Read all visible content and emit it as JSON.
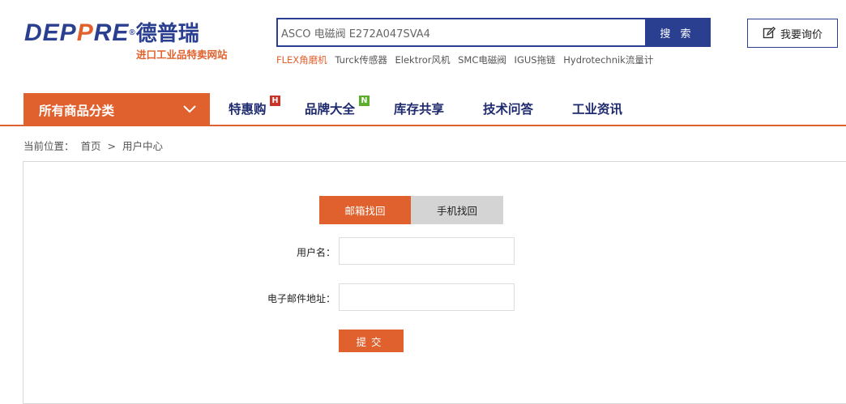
{
  "logo": {
    "brand_part1": "DEP",
    "brand_part2": "P",
    "brand_part3": "RE",
    "brand_cn": "德普瑞",
    "registered": "®",
    "tagline": "进口工业品特卖网站"
  },
  "search": {
    "value": "ASCO 电磁阀 E272A047SVA4",
    "button_label": "搜 索"
  },
  "hot_links": [
    {
      "label": "FLEX角磨机",
      "highlight": true
    },
    {
      "label": "Turck传感器",
      "highlight": false
    },
    {
      "label": "Elektror风机",
      "highlight": false
    },
    {
      "label": "SMC电磁阀",
      "highlight": false
    },
    {
      "label": "IGUS拖链",
      "highlight": false
    },
    {
      "label": "Hydrotechnik流量计",
      "highlight": false
    }
  ],
  "inquiry_button": {
    "label": "我要询价",
    "icon": "edit-icon"
  },
  "nav": {
    "category_label": "所有商品分类",
    "items": [
      {
        "label": "特惠购",
        "badge": "H",
        "badge_color": "#c8342a"
      },
      {
        "label": "品牌大全",
        "badge": "N",
        "badge_color": "#5aae2c"
      },
      {
        "label": "库存共享",
        "badge": ""
      },
      {
        "label": "技术问答",
        "badge": ""
      },
      {
        "label": "工业资讯",
        "badge": ""
      }
    ]
  },
  "breadcrumb": {
    "prefix": "当前位置：",
    "home": "首页",
    "separator": ">",
    "current": "用户中心"
  },
  "recover_tabs": [
    {
      "label": "邮箱找回",
      "active": true
    },
    {
      "label": "手机找回",
      "active": false
    }
  ],
  "form": {
    "username_label": "用户名：",
    "username_value": "",
    "email_label": "电子邮件地址：",
    "email_value": "",
    "submit_label": "提交"
  },
  "colors": {
    "accent": "#e0612d",
    "brand_blue": "#2a3f8f",
    "nav_text": "#1e2a6e"
  }
}
